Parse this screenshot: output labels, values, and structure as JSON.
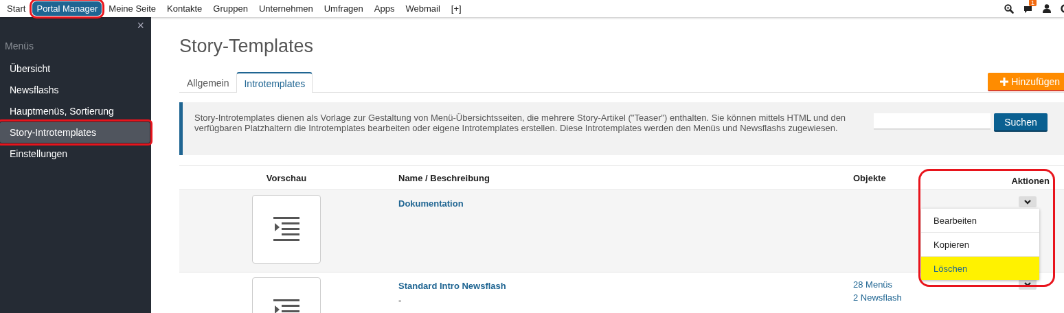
{
  "nav": {
    "items": [
      {
        "label": "Start",
        "selected": false,
        "annotated": false
      },
      {
        "label": "Portal Manager",
        "selected": true,
        "annotated": true
      },
      {
        "label": "Meine Seite",
        "selected": false,
        "annotated": false
      },
      {
        "label": "Kontakte",
        "selected": false,
        "annotated": false
      },
      {
        "label": "Gruppen",
        "selected": false,
        "annotated": false
      },
      {
        "label": "Unternehmen",
        "selected": false,
        "annotated": false
      },
      {
        "label": "Umfragen",
        "selected": false,
        "annotated": false
      },
      {
        "label": "Apps",
        "selected": false,
        "annotated": false
      },
      {
        "label": "Webmail",
        "selected": false,
        "annotated": false
      },
      {
        "label": "[+]",
        "selected": false,
        "annotated": false
      }
    ],
    "message_badge": "1"
  },
  "sidebar": {
    "close": "×",
    "heading": "Menüs",
    "items": [
      {
        "label": "Übersicht",
        "selected": false,
        "annotated": false
      },
      {
        "label": "Newsflashs",
        "selected": false,
        "annotated": false
      },
      {
        "label": "Hauptmenüs, Sortierung",
        "selected": false,
        "annotated": false
      },
      {
        "label": "Story-Introtemplates",
        "selected": true,
        "annotated": true
      },
      {
        "label": "Einstellungen",
        "selected": false,
        "annotated": false
      }
    ]
  },
  "page": {
    "title": "Story-Templates",
    "tabs": [
      {
        "label": "Allgemein",
        "selected": false
      },
      {
        "label": "Introtemplates",
        "selected": true
      }
    ],
    "add_button": "Hinzufügen",
    "info": "Story-Introtemplates dienen als Vorlage zur Gestaltung von Menü-Übersichtsseiten, die mehrere Story-Artikel (\"Teaser\") enthalten. Sie können mittels HTML und den verfügbaren Platzhaltern die Introtemplates bearbeiten oder eigene Introtemplates erstellen. Diese Introtemplates werden den Menüs und Newsflashs zugewiesen.",
    "search": {
      "button": "Suchen"
    }
  },
  "table": {
    "columns": [
      "Vorschau",
      "Name / Beschreibung",
      "Objekte",
      "Aktionen"
    ],
    "actions_annotated": true,
    "rows": [
      {
        "name": "Dokumentation",
        "description": "",
        "objects": [],
        "menu_open": true
      },
      {
        "name": "Standard Intro Newsflash",
        "description": "-",
        "objects": [
          "28 Menüs",
          "2 Newsflash"
        ],
        "menu_open": false
      }
    ],
    "action_menu": [
      {
        "label": "Bearbeiten",
        "selected": false
      },
      {
        "label": "Kopieren",
        "selected": false
      },
      {
        "label": "Löschen",
        "selected": true
      }
    ]
  }
}
